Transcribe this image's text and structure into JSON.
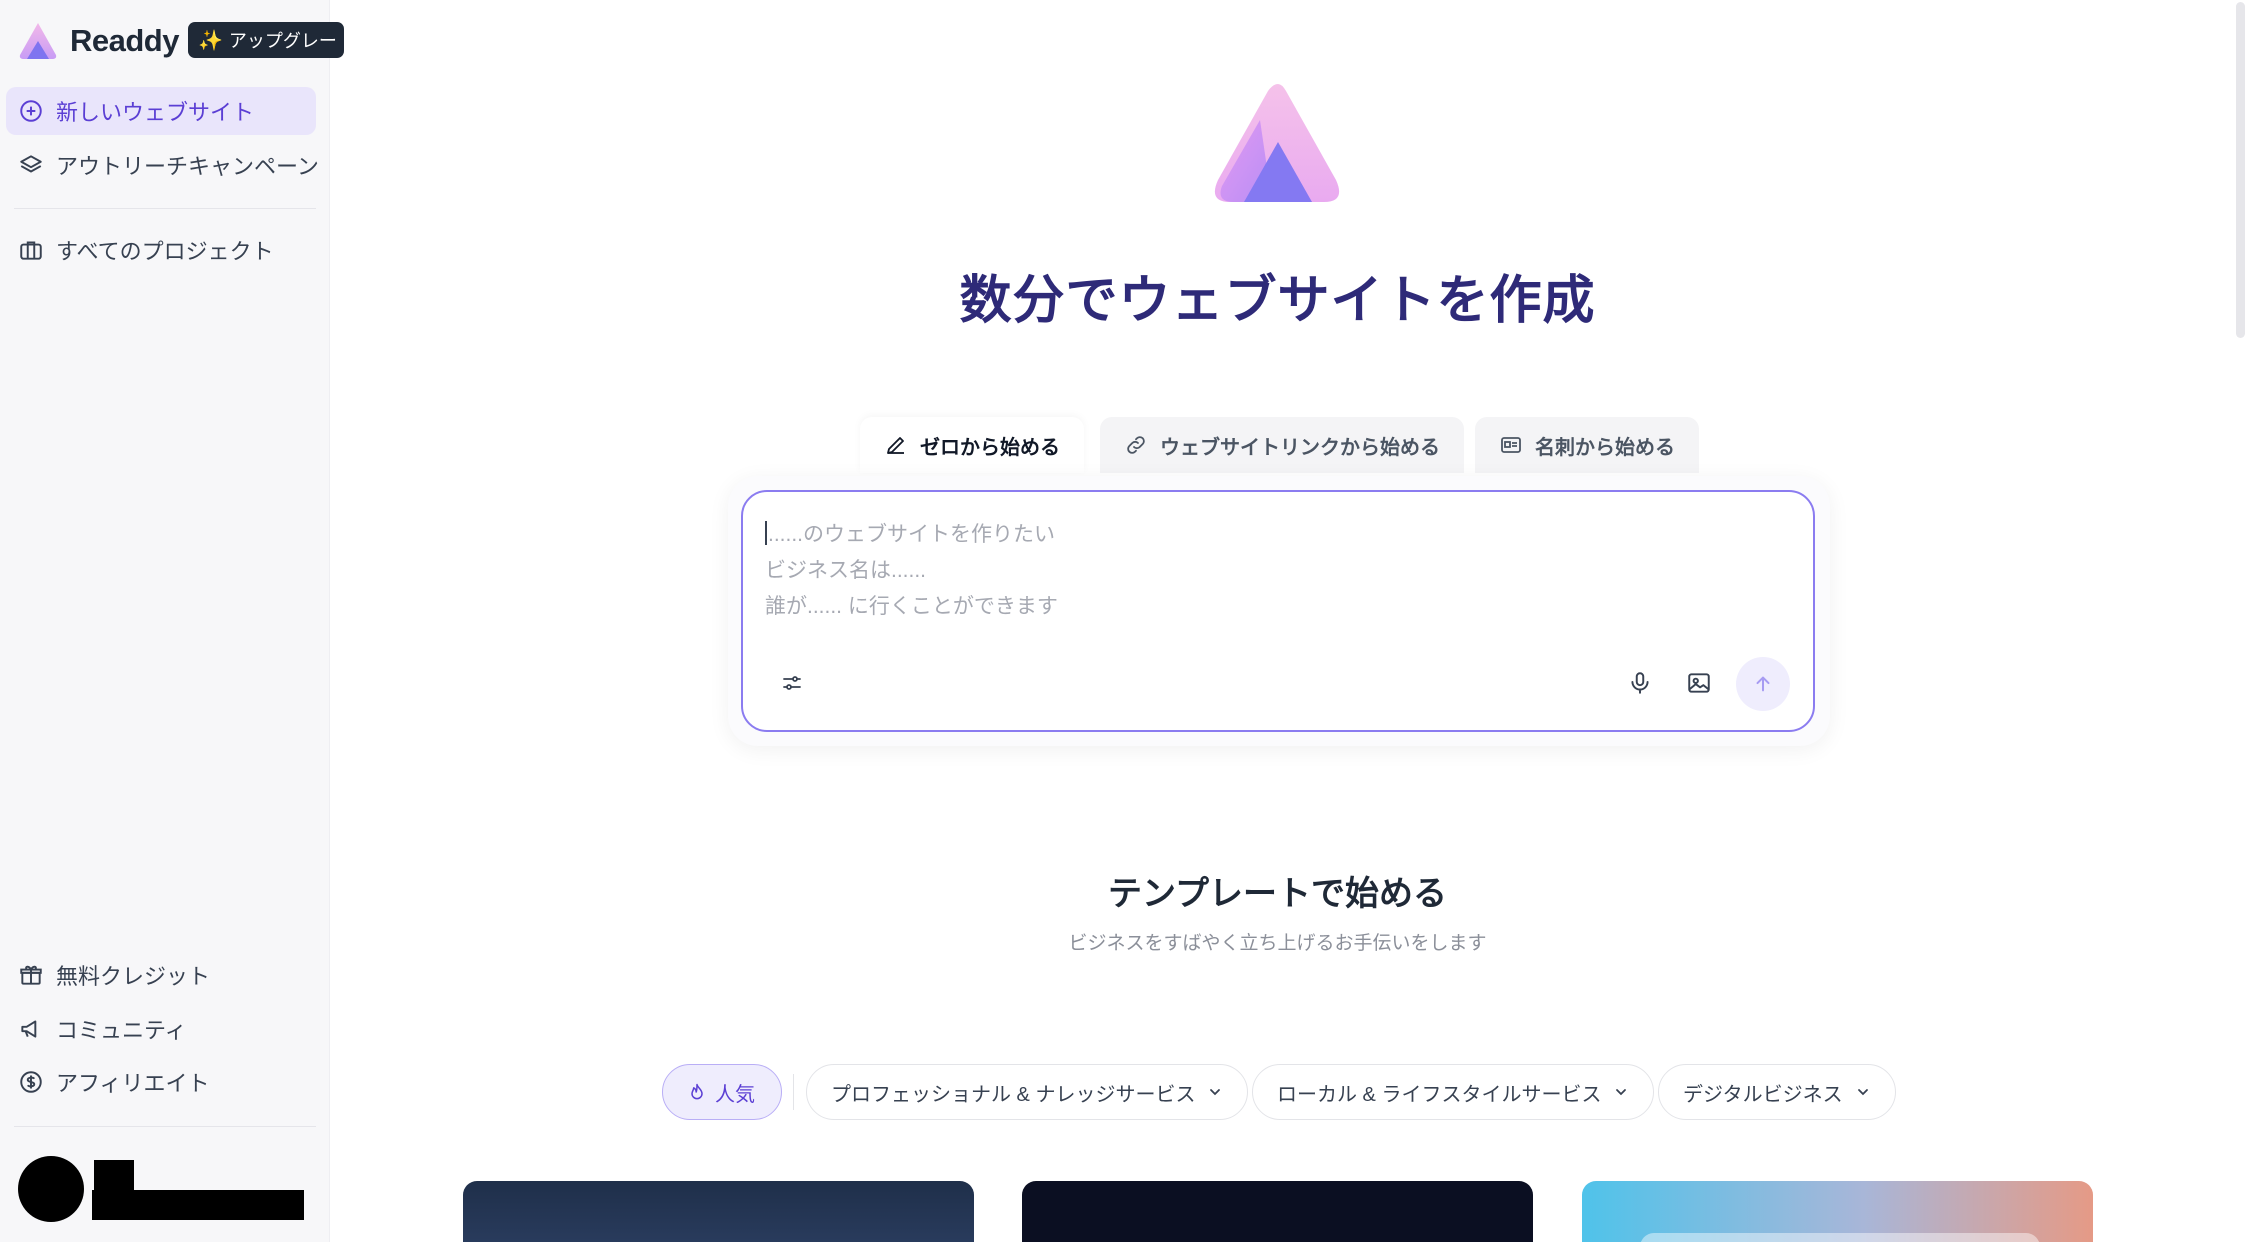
{
  "brand": {
    "name": "Readdy",
    "upgrade_label": "アップグレー"
  },
  "sidebar": {
    "items": [
      {
        "label": "新しいウェブサイト",
        "icon": "plus-circle-icon",
        "active": true
      },
      {
        "label": "アウトリーチキャンペーン",
        "icon": "layers-icon"
      },
      {
        "label": "すべてのプロジェクト",
        "icon": "briefcase-icon"
      }
    ],
    "bottom_items": [
      {
        "label": "無料クレジット",
        "icon": "gift-icon"
      },
      {
        "label": "コミュニティ",
        "icon": "megaphone-icon"
      },
      {
        "label": "アフィリエイト",
        "icon": "dollar-circle-icon"
      }
    ]
  },
  "hero": {
    "title": "数分でウェブサイトを作成"
  },
  "tabs": [
    {
      "label": "ゼロから始める",
      "icon": "pencil-icon",
      "active": true
    },
    {
      "label": "ウェブサイトリンクから始める",
      "icon": "link-icon"
    },
    {
      "label": "名刺から始める",
      "icon": "id-card-icon"
    }
  ],
  "prompt": {
    "placeholder_lines": [
      "......のウェブサイトを作りたい",
      "ビジネス名は......",
      "誰が...... に行くことができます"
    ]
  },
  "templates": {
    "title": "テンプレートで始める",
    "subtitle": "ビジネスをすばやく立ち上げるお手伝いをします",
    "filters": [
      {
        "label": "人気",
        "icon": "flame-icon",
        "active": true
      },
      {
        "label": "プロフェッショナル & ナレッジサービス"
      },
      {
        "label": "ローカル & ライフスタイルサービス"
      },
      {
        "label": "デジタルビジネス"
      }
    ]
  },
  "colors": {
    "accent": "#5b3fd4",
    "accent_soft": "#e9e5fb",
    "title": "#2e2a78",
    "prompt_border": "#8b7cf0"
  }
}
